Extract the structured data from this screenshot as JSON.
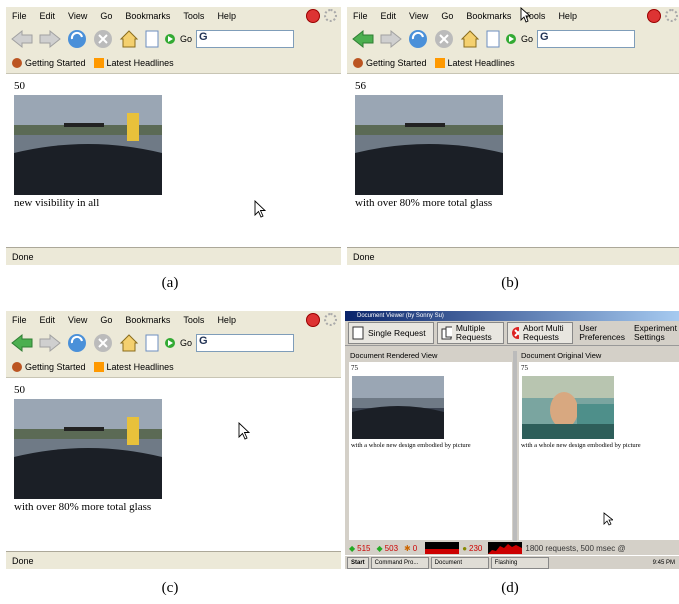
{
  "browser": {
    "menu": [
      "File",
      "Edit",
      "View",
      "Go",
      "Bookmarks",
      "Tools",
      "Help"
    ],
    "go_label": "Go",
    "search_logo": "G",
    "bookmarks": [
      "Getting Started",
      "Latest Headlines"
    ],
    "status": "Done"
  },
  "panels": {
    "a": {
      "counter": "50",
      "caption": "new visibility in all",
      "label": "(a)"
    },
    "b": {
      "counter": "56",
      "caption": "with over 80% more total glass",
      "label": "(b)"
    },
    "c": {
      "counter": "50",
      "caption": "with over 80% more total glass",
      "label": "(c)"
    },
    "d": {
      "label": "(d)"
    }
  },
  "viewer": {
    "title": "Document Viewer (by Sonny Su)",
    "buttons": {
      "single": "Single Request",
      "multiple": "Multiple Requests",
      "abort": "Abort Multi Requests",
      "prefs": "User Preferences",
      "experiment": "Experiment Settings"
    },
    "left_header": "Document Rendered View",
    "right_header": "Document Original View",
    "left_counter": "75",
    "right_counter": "75",
    "left_caption": "with a whole new design embodied by picture",
    "right_caption": "with a whole new design embodied by picture",
    "stats": {
      "s1": "515",
      "s2": "503",
      "s3": "0",
      "s4": "230",
      "summary": "1800 requests, 500 msec @"
    },
    "taskbar": {
      "start": "Start",
      "t1": "Command Pro...",
      "t2": "Document Viewe...",
      "t3": "Flashing",
      "clock": "9:45 PM"
    }
  },
  "colors": {
    "chrome": "#ece9d8",
    "viewer_bg": "#d4d0c8",
    "stat_red": "#cc0000"
  }
}
